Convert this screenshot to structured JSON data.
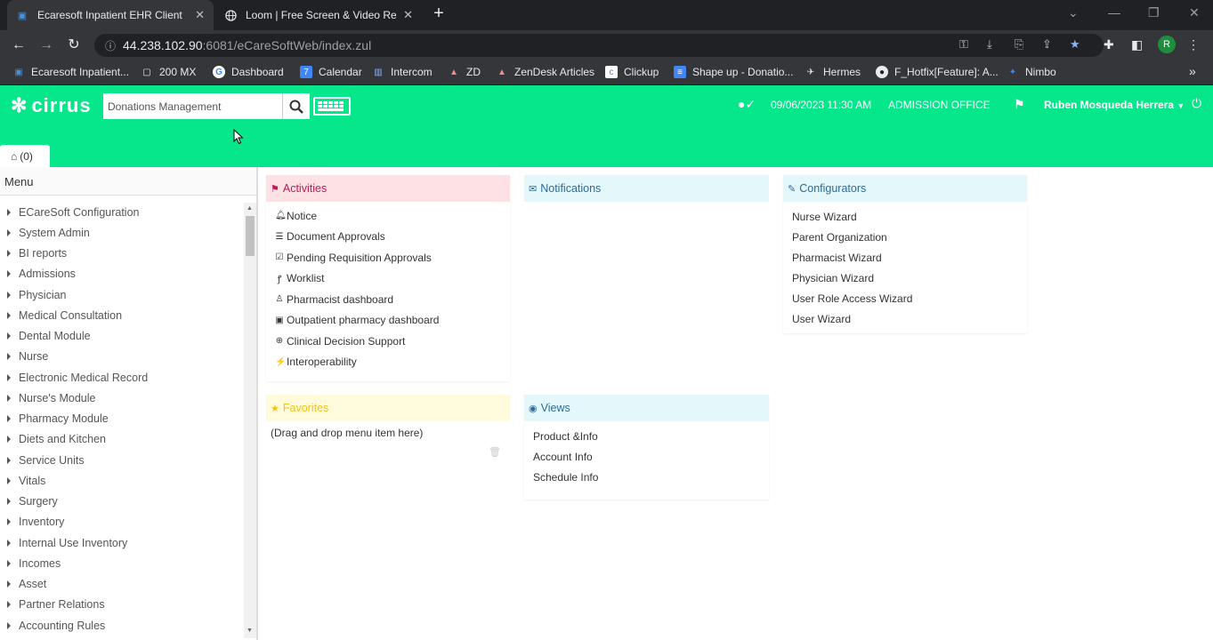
{
  "browser": {
    "tabs": [
      {
        "title": "Ecaresoft Inpatient EHR Client",
        "active": true
      },
      {
        "title": "Loom | Free Screen & Video Reco",
        "active": false
      }
    ],
    "url_host": "44.238.102.90",
    "url_path": ":6081/eCareSoftWeb/index.zul",
    "profile_initial": "R",
    "bookmarks": [
      "Ecaresoft Inpatient...",
      "200 MX",
      "Dashboard",
      "Calendar",
      "Intercom",
      "ZD",
      "ZenDesk Articles",
      "Clickup",
      "Shape up - Donatio...",
      "Hermes",
      "F_Hotfix[Feature]: A...",
      "Nimbo"
    ],
    "bookmarks_overflow": "»"
  },
  "app": {
    "logo": "cirrus",
    "search_value": "Donations Management",
    "datetime": "09/06/2023 11:30 AM",
    "department": "ADMISSION OFFICE",
    "user": "Ruben Mosqueda Herrera",
    "home_tab": "(0)",
    "colors": {
      "brand": "#06e68a",
      "activities": "#d81b60",
      "notifications": "#337ab7",
      "favorites": "#f0c419"
    }
  },
  "sidebar": {
    "title": "Menu",
    "items": [
      "ECareSoft Configuration",
      "System Admin",
      "BI reports",
      "Admissions",
      "Physician",
      "Medical Consultation",
      "Dental Module",
      "Nurse",
      "Electronic Medical Record",
      "Nurse's Module",
      "Pharmacy Module",
      "Diets and Kitchen",
      "Service Units",
      "Vitals",
      "Surgery",
      "Inventory",
      "Internal Use Inventory",
      "Incomes",
      "Asset",
      "Partner Relations",
      "Accounting Rules"
    ]
  },
  "activities": {
    "title": "Activities",
    "items": [
      {
        "label": "Notice",
        "icon": "bell-icon"
      },
      {
        "label": "Document Approvals",
        "icon": "list-icon"
      },
      {
        "label": "Pending Requisition Approvals",
        "icon": "check-square-icon"
      },
      {
        "label": "Worklist",
        "icon": "stethoscope-icon"
      },
      {
        "label": "Pharmacist dashboard",
        "icon": "user-md-icon"
      },
      {
        "label": "Outpatient pharmacy dashboard",
        "icon": "medkit-icon"
      },
      {
        "label": "Clinical Decision Support",
        "icon": "lifebuoy-icon"
      },
      {
        "label": "Interoperability",
        "icon": "plug-icon"
      }
    ]
  },
  "notifications": {
    "title": "Notifications"
  },
  "configurators": {
    "title": "Configurators",
    "items": [
      "Nurse Wizard",
      "Parent Organization",
      "Pharmacist Wizard",
      "Physician Wizard",
      "User Role Access Wizard",
      "User Wizard"
    ]
  },
  "favorites": {
    "title": "Favorites",
    "placeholder": "(Drag and drop menu item here)"
  },
  "views": {
    "title": "Views",
    "items": [
      "Product &Info",
      "Account Info",
      "Schedule Info"
    ]
  }
}
